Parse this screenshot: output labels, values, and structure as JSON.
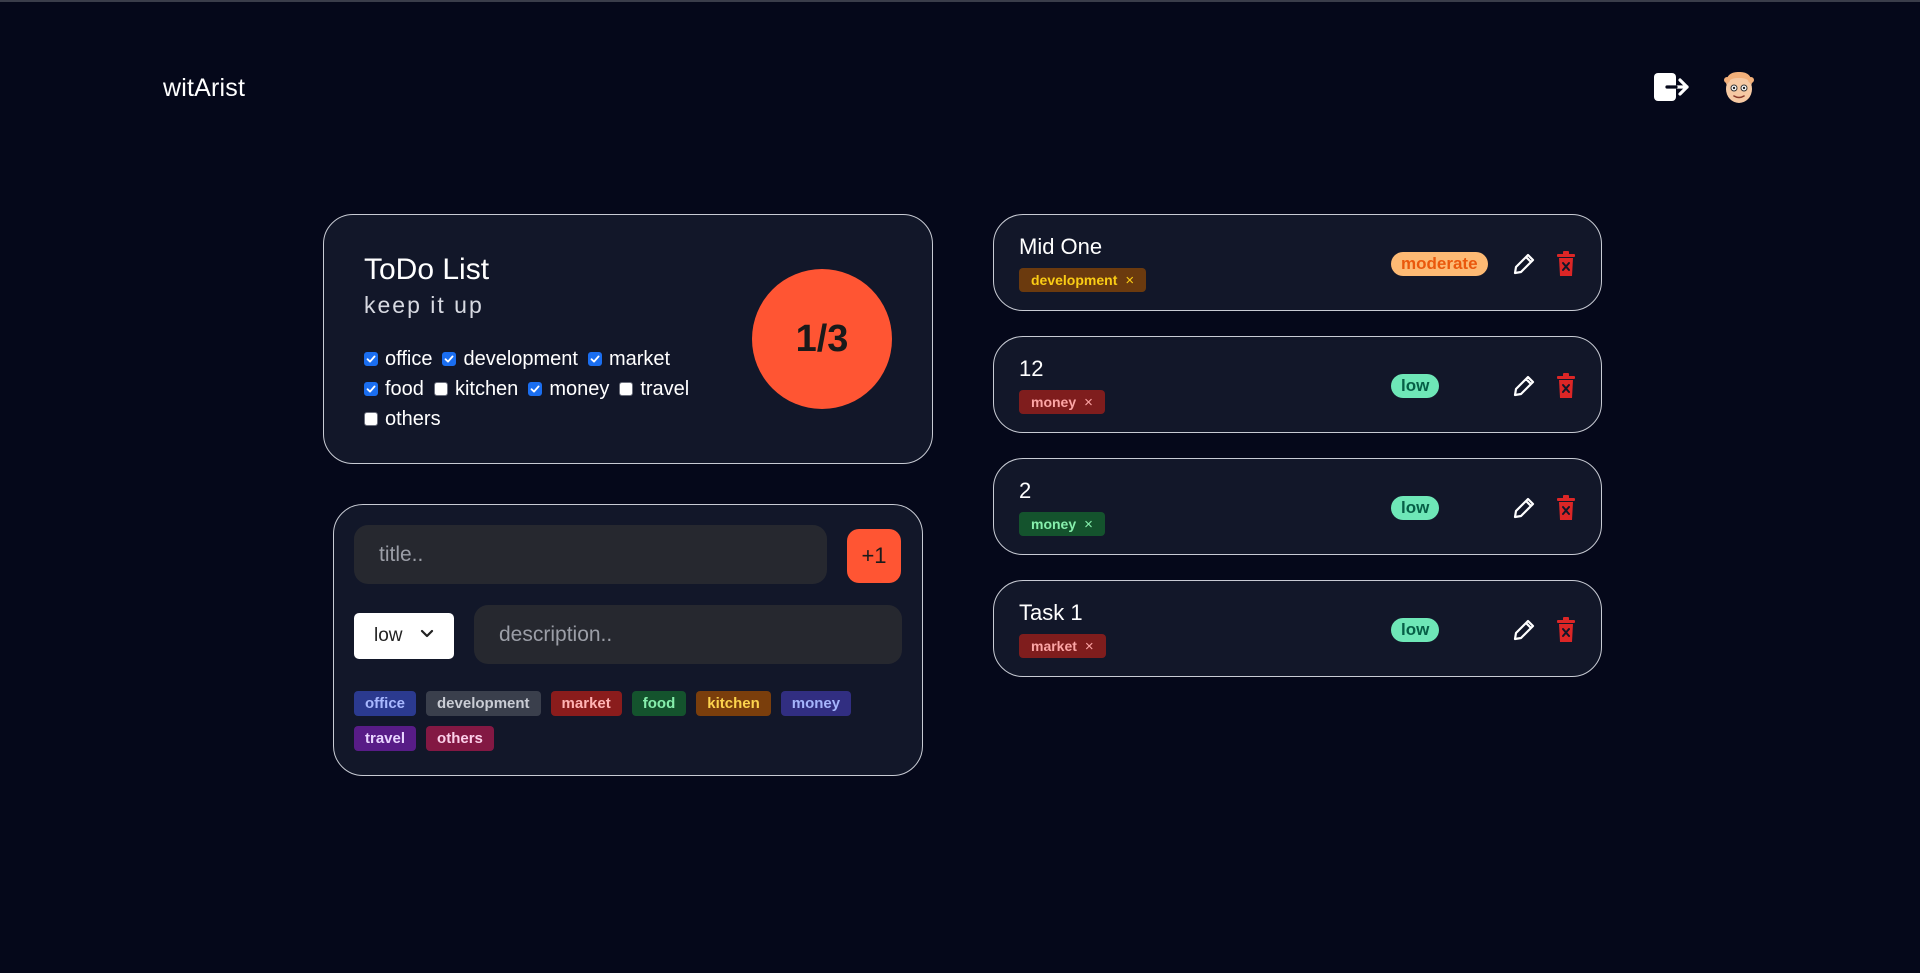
{
  "header": {
    "brand": "witArist",
    "logout_icon": "logout-icon",
    "avatar_icon": "avatar-face"
  },
  "summary": {
    "title": "ToDo List",
    "subtitle": "keep it up",
    "progress": "1/3",
    "progress_color": "#ff5533",
    "filters": [
      {
        "label": "office",
        "checked": true
      },
      {
        "label": "development",
        "checked": true
      },
      {
        "label": "market",
        "checked": true
      },
      {
        "label": "food",
        "checked": true
      },
      {
        "label": "kitchen",
        "checked": false
      },
      {
        "label": "money",
        "checked": true
      },
      {
        "label": "travel",
        "checked": false
      },
      {
        "label": "others",
        "checked": false
      }
    ]
  },
  "adder": {
    "title_placeholder": "title..",
    "add_label": "+1",
    "priority_value": "low",
    "description_placeholder": "description..",
    "tags": [
      {
        "label": "office",
        "bg": "#2b3a8f",
        "fg": "#a9b9ff"
      },
      {
        "label": "development",
        "bg": "#3a3f4c",
        "fg": "#c9ccd4"
      },
      {
        "label": "market",
        "bg": "#8a1c1c",
        "fg": "#ffb3b3"
      },
      {
        "label": "food",
        "bg": "#14532d",
        "fg": "#86efac"
      },
      {
        "label": "kitchen",
        "bg": "#7a3e0c",
        "fg": "#fcd34d"
      },
      {
        "label": "money",
        "bg": "#312e81",
        "fg": "#a5b4fc"
      },
      {
        "label": "travel",
        "bg": "#581c87",
        "fg": "#e9d5ff"
      },
      {
        "label": "others",
        "bg": "#831843",
        "fg": "#fbcfe8"
      }
    ]
  },
  "tasks": [
    {
      "title": "Mid One",
      "tag": "development",
      "tag_bg": "#6b3a0e",
      "tag_fg": "#facc15",
      "priority": "moderate",
      "prio_bg": "#fdba74",
      "prio_fg": "#ea580c"
    },
    {
      "title": "12",
      "tag": "money",
      "tag_bg": "#7f1d1d",
      "tag_fg": "#fca5a5",
      "priority": "low",
      "prio_bg": "#6ee7b7",
      "prio_fg": "#065f46"
    },
    {
      "title": "2",
      "tag": "money",
      "tag_bg": "#14532d",
      "tag_fg": "#86efac",
      "priority": "low",
      "prio_bg": "#6ee7b7",
      "prio_fg": "#065f46"
    },
    {
      "title": "Task 1",
      "tag": "market",
      "tag_bg": "#7f1d1d",
      "tag_fg": "#fca5a5",
      "priority": "low",
      "prio_bg": "#6ee7b7",
      "prio_fg": "#065f46"
    }
  ],
  "tag_remove_glyph": "×",
  "colors": {
    "background": "#05081a",
    "card": "#121729",
    "accent": "#ff5533",
    "delete": "#dc2626"
  }
}
